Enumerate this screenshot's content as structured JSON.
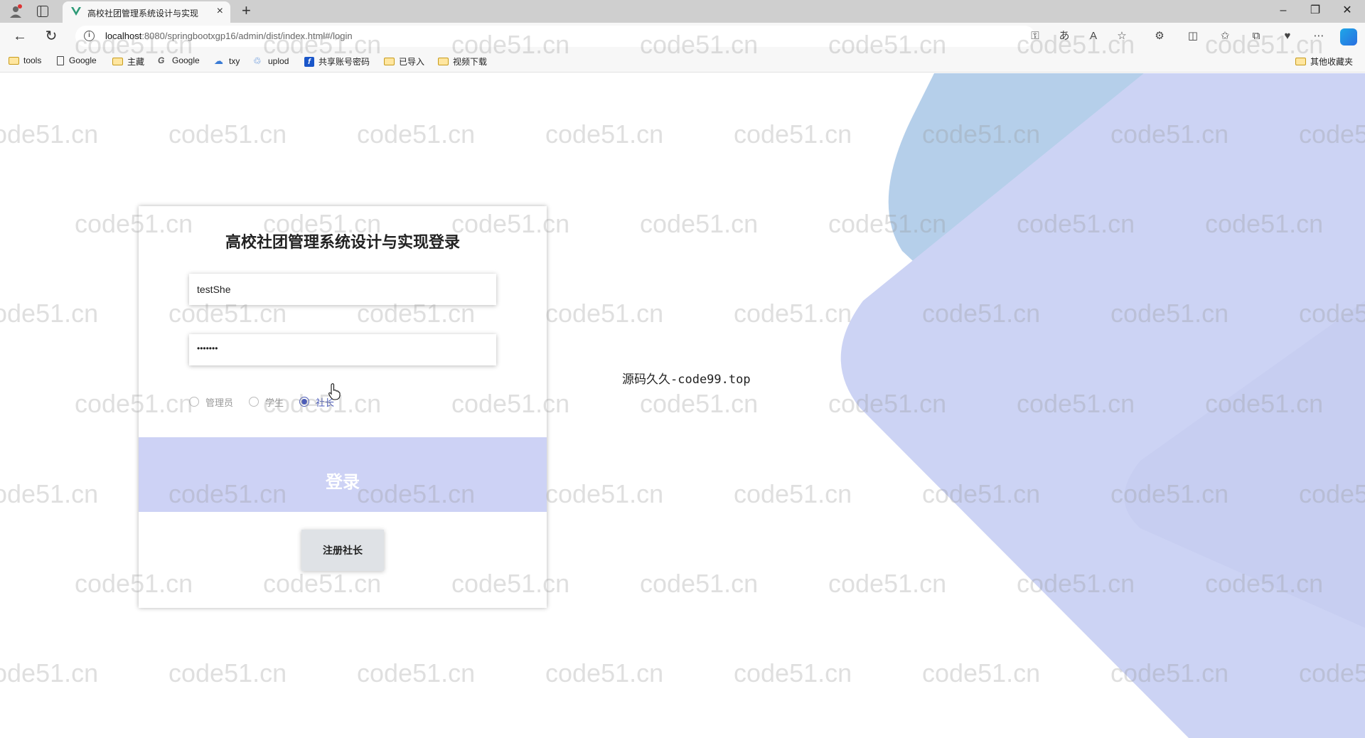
{
  "browser": {
    "tab_title": "高校社团管理系统设计与实现",
    "url_host": "localhost",
    "url_rest": ":8080/springbootxgp16/admin/dist/index.html#/login",
    "bookmarks": [
      "tools",
      "Google",
      "主藏",
      "Google",
      "txy",
      "uplod",
      "共享账号密码",
      "已导入",
      "视频下载"
    ],
    "other_bookmarks": "其他收藏夹"
  },
  "login": {
    "title": "高校社团管理系统设计与实现登录",
    "username_value": "testShe",
    "password_mask": "•••••••",
    "roles": [
      "管理员",
      "学生",
      "社长"
    ],
    "selected_role": "社长",
    "login_label": "登录",
    "register_label": "注册社长"
  },
  "side_note": "源码久久-code99.top",
  "watermark_text": "code51.cn",
  "colors": {
    "accent": "#4b5bb8",
    "login_button": "#cdd2f5",
    "shape_blue": "#b3cdea",
    "shape_lavender": "#ccd2f3"
  }
}
